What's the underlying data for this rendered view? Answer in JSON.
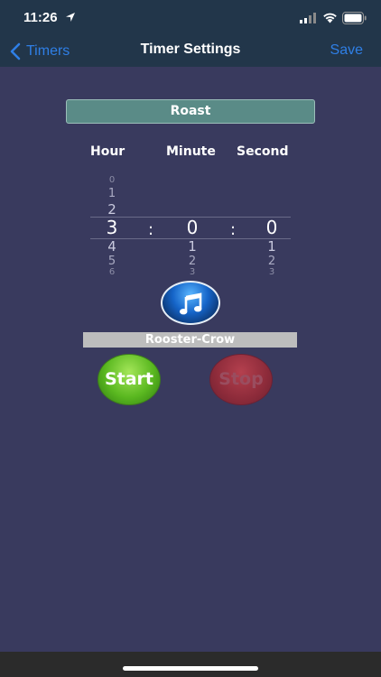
{
  "status_bar": {
    "time": "11:26"
  },
  "nav": {
    "back_label": "Timers",
    "title": "Timer Settings",
    "save_label": "Save"
  },
  "timer": {
    "name": "Roast",
    "labels": {
      "hour": "Hour",
      "minute": "Minute",
      "second": "Second"
    },
    "hour_picker": {
      "above": [
        "0",
        "1",
        "2"
      ],
      "selected": "3",
      "below": [
        "4",
        "5",
        "6"
      ]
    },
    "minute_picker": {
      "selected": "0",
      "below": [
        "1",
        "2",
        "3"
      ]
    },
    "second_picker": {
      "selected": "0",
      "below": [
        "1",
        "2",
        "3"
      ]
    },
    "separator": ":"
  },
  "sound": {
    "icon": "music-note-icon",
    "name": "Rooster-Crow"
  },
  "controls": {
    "start_label": "Start",
    "stop_label": "Stop"
  },
  "colors": {
    "background": "#393a5e",
    "nav_background": "#22364a",
    "accent": "#2f7fe6",
    "name_field": "#5a8b87",
    "start": "#5ab820",
    "stop": "#8d2b3a"
  }
}
